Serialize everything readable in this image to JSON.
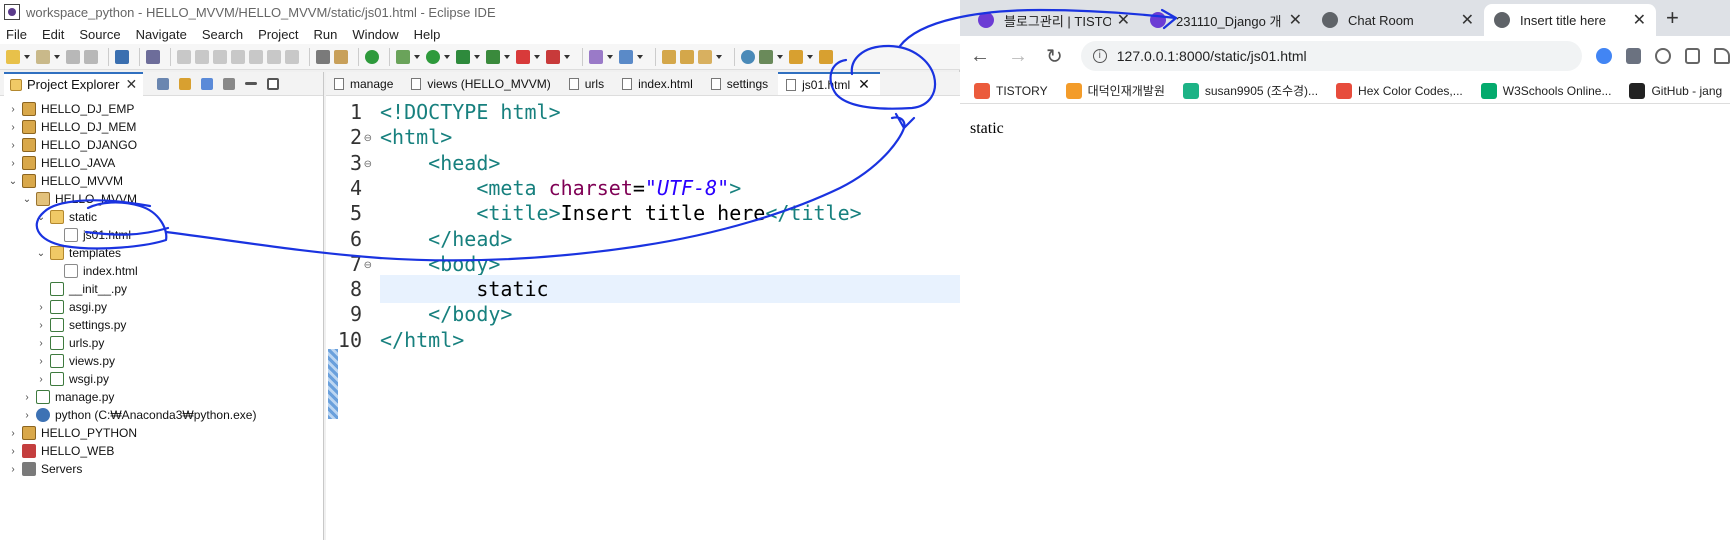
{
  "eclipse": {
    "title": "workspace_python - HELLO_MVVM/HELLO_MVVM/static/js01.html - Eclipse IDE",
    "menu": [
      "File",
      "Edit",
      "Source",
      "Navigate",
      "Search",
      "Project",
      "Run",
      "Window",
      "Help"
    ],
    "explorer": {
      "tab_label": "Project Explorer",
      "items": [
        {
          "label": "HELLO_DJ_EMP",
          "indent": 0,
          "twisty": "›",
          "icon": "proj"
        },
        {
          "label": "HELLO_DJ_MEM",
          "indent": 0,
          "twisty": "›",
          "icon": "proj"
        },
        {
          "label": "HELLO_DJANGO",
          "indent": 0,
          "twisty": "›",
          "icon": "proj"
        },
        {
          "label": "HELLO_JAVA",
          "indent": 0,
          "twisty": "›",
          "icon": "proj"
        },
        {
          "label": "HELLO_MVVM",
          "indent": 0,
          "twisty": "⌄",
          "icon": "proj"
        },
        {
          "label": "HELLO_MVVM",
          "indent": 1,
          "twisty": "⌄",
          "icon": "pkg"
        },
        {
          "label": "static",
          "indent": 2,
          "twisty": "⌄",
          "icon": "fld"
        },
        {
          "label": "js01.html",
          "indent": 3,
          "twisty": "",
          "icon": "file"
        },
        {
          "label": "templates",
          "indent": 2,
          "twisty": "⌄",
          "icon": "fld"
        },
        {
          "label": "index.html",
          "indent": 3,
          "twisty": "",
          "icon": "file"
        },
        {
          "label": "__init__.py",
          "indent": 2,
          "twisty": "",
          "icon": "py"
        },
        {
          "label": "asgi.py",
          "indent": 2,
          "twisty": "›",
          "icon": "py"
        },
        {
          "label": "settings.py",
          "indent": 2,
          "twisty": "›",
          "icon": "py"
        },
        {
          "label": "urls.py",
          "indent": 2,
          "twisty": "›",
          "icon": "py"
        },
        {
          "label": "views.py",
          "indent": 2,
          "twisty": "›",
          "icon": "py"
        },
        {
          "label": "wsgi.py",
          "indent": 2,
          "twisty": "›",
          "icon": "py"
        },
        {
          "label": "manage.py",
          "indent": 1,
          "twisty": "›",
          "icon": "py"
        },
        {
          "label": "python  (C:₩Anaconda3₩python.exe)",
          "indent": 1,
          "twisty": "›",
          "icon": "pyenv"
        },
        {
          "label": "HELLO_PYTHON",
          "indent": 0,
          "twisty": "›",
          "icon": "proj"
        },
        {
          "label": "HELLO_WEB",
          "indent": 0,
          "twisty": "›",
          "icon": "web"
        },
        {
          "label": "Servers",
          "indent": 0,
          "twisty": "›",
          "icon": "srv"
        }
      ]
    },
    "editor_tabs": [
      {
        "label": "manage",
        "active": false
      },
      {
        "label": "views (HELLO_MVVM)",
        "active": false
      },
      {
        "label": "urls",
        "active": false
      },
      {
        "label": "index.html",
        "active": false
      },
      {
        "label": "settings",
        "active": false
      },
      {
        "label": "js01.html",
        "active": true
      }
    ],
    "code_lines": [
      {
        "n": "1",
        "fold": "",
        "parts": [
          [
            "tag",
            "<!DOCTYPE html>"
          ]
        ]
      },
      {
        "n": "2",
        "fold": "⊖",
        "parts": [
          [
            "tag",
            "<html>"
          ]
        ]
      },
      {
        "n": "3",
        "fold": "⊖",
        "parts": [
          [
            "txt",
            "    "
          ],
          [
            "tag",
            "<head>"
          ]
        ]
      },
      {
        "n": "4",
        "fold": "",
        "parts": [
          [
            "txt",
            "        "
          ],
          [
            "tag",
            "<meta "
          ],
          [
            "attr",
            "charset"
          ],
          [
            "txt",
            "="
          ],
          [
            "str",
            "\"UTF-8\""
          ],
          [
            "tag",
            ">"
          ]
        ]
      },
      {
        "n": "5",
        "fold": "",
        "parts": [
          [
            "txt",
            "        "
          ],
          [
            "tag",
            "<title>"
          ],
          [
            "txt",
            "Insert title here"
          ],
          [
            "tag",
            "</title>"
          ]
        ]
      },
      {
        "n": "6",
        "fold": "",
        "parts": [
          [
            "txt",
            "    "
          ],
          [
            "tag",
            "</head>"
          ]
        ]
      },
      {
        "n": "7",
        "fold": "⊖",
        "parts": [
          [
            "txt",
            "    "
          ],
          [
            "tag",
            "<body>"
          ]
        ]
      },
      {
        "n": "8",
        "fold": "",
        "parts": [
          [
            "txt",
            "        static"
          ]
        ],
        "highlight": true
      },
      {
        "n": "9",
        "fold": "",
        "parts": [
          [
            "txt",
            "    "
          ],
          [
            "tag",
            "</body>"
          ]
        ]
      },
      {
        "n": "10",
        "fold": "",
        "parts": [
          [
            "tag",
            "</html>"
          ]
        ]
      }
    ]
  },
  "browser": {
    "tabs": [
      {
        "label": "블로그관리 | TISTO",
        "color": "#6c3cd4",
        "active": false
      },
      {
        "label": "231110_Django 개",
        "color": "#6c3cd4",
        "active": false
      },
      {
        "label": "Chat Room",
        "color": "#5f6368",
        "active": false
      },
      {
        "label": "Insert title here",
        "color": "#5f6368",
        "active": true
      }
    ],
    "url": "127.0.0.1:8000/static/js01.html",
    "bookmarks": [
      {
        "label": "TISTORY",
        "color": "#eb5b3c"
      },
      {
        "label": "대덕인재개발원",
        "color": "#f39c2a"
      },
      {
        "label": "susan9905 (조수경)...",
        "color": "#1db386"
      },
      {
        "label": "Hex Color Codes,...",
        "color": "#e74c3c"
      },
      {
        "label": "W3Schools Online...",
        "color": "#04aa6d"
      },
      {
        "label": "GitHub - jang",
        "color": "#222222"
      }
    ],
    "page_text": "static"
  }
}
